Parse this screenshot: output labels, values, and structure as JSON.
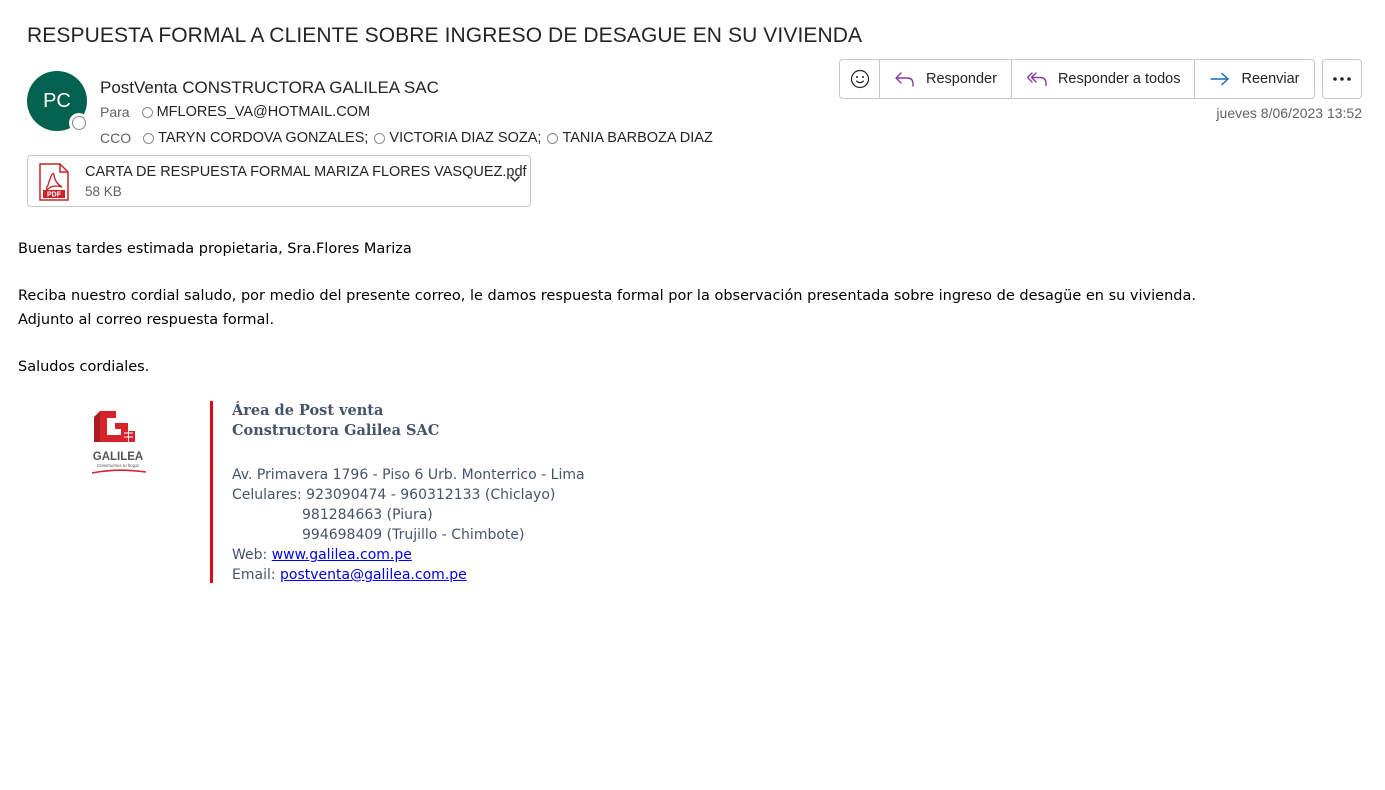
{
  "email": {
    "subject": "RESPUESTA FORMAL A CLIENTE SOBRE INGRESO DE DESAGUE EN SU VIVIENDA",
    "sender": {
      "initials": "PC",
      "name": "PostVenta CONSTRUCTORA GALILEA SAC",
      "avatar_color": "#03614f"
    },
    "to_label": "Para",
    "to": [
      "MFLORES_VA@HOTMAIL.COM"
    ],
    "cc_label": "CCO",
    "cc": [
      "TARYN CORDOVA GONZALES;",
      "VICTORIA DIAZ SOZA;",
      "TANIA BARBOZA DIAZ"
    ],
    "date": "jueves 8/06/2023 13:52"
  },
  "toolbar": {
    "emoji_icon": "smiley-icon",
    "reply_label": "Responder",
    "reply_all_label": "Responder a todos",
    "forward_label": "Reenviar",
    "more_icon": "ellipsis-icon",
    "accent_color": "#8c3a9d",
    "forward_color": "#0f6cbd"
  },
  "attachment": {
    "name": "CARTA DE RESPUESTA FORMAL MARIZA FLORES VASQUEZ.pdf",
    "size": "58 KB",
    "icon": "pdf-icon",
    "icon_label": "PDF"
  },
  "body": {
    "greeting": "Buenas tardes estimada propietaria, Sra.Flores Mariza",
    "line1": "Reciba nuestro cordial saludo, por medio del presente correo, le damos respuesta formal por la observación presentada sobre ingreso de desagüe en su vivienda.",
    "line2": "Adjunto al correo respuesta formal.",
    "closing": "Saludos cordiales."
  },
  "signature": {
    "logo_text": "GALILEA",
    "logo_tagline": "Construimos tu hogar",
    "area": "Área de Post venta",
    "company": "Constructora Galilea SAC",
    "address": "Av. Primavera 1796 - Piso 6 Urb. Monterrico - Lima",
    "phones_label": "Celulares:",
    "phone1": "923090474 - 960312133 (Chiclayo)",
    "phone2": "981284663 (Piura)",
    "phone3": "994698409 (Trujillo - Chimbote)",
    "web_label": "Web:",
    "web": "www.galilea.com.pe",
    "email_label": "Email:",
    "email": "postventa@galilea.com.pe",
    "brand_color": "#e30613"
  }
}
